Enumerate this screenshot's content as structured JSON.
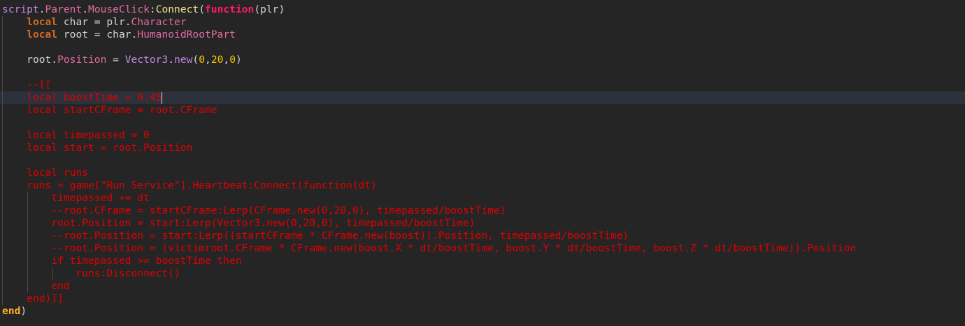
{
  "editor": {
    "cursor_line": 8,
    "lines": [
      {
        "indent": 0,
        "tokens": [
          [
            "script",
            "s"
          ],
          [
            ".",
            "t"
          ],
          [
            "Parent",
            "p"
          ],
          [
            ".",
            "t"
          ],
          [
            "MouseClick",
            "p"
          ],
          [
            ":",
            "t"
          ],
          [
            "Connect",
            "f"
          ],
          [
            "(",
            "t"
          ],
          [
            "function",
            "kw"
          ],
          [
            "(plr)",
            "t"
          ]
        ]
      },
      {
        "indent": 1,
        "tokens": [
          [
            "local",
            "loc"
          ],
          [
            " char = plr.",
            "t"
          ],
          [
            "Character",
            "p"
          ]
        ]
      },
      {
        "indent": 1,
        "tokens": [
          [
            "local",
            "loc"
          ],
          [
            " root = char.",
            "t"
          ],
          [
            "HumanoidRootPart",
            "p"
          ]
        ]
      },
      {
        "indent": 0,
        "tokens": []
      },
      {
        "indent": 1,
        "tokens": [
          [
            "root.",
            "t"
          ],
          [
            "Position",
            "p"
          ],
          [
            " = ",
            "t"
          ],
          [
            "Vector3",
            "v"
          ],
          [
            ".",
            "t"
          ],
          [
            "new",
            "v"
          ],
          [
            "(",
            "t"
          ],
          [
            "0",
            "n"
          ],
          [
            ",",
            "t"
          ],
          [
            "20",
            "n"
          ],
          [
            ",",
            "t"
          ],
          [
            "0",
            "n"
          ],
          [
            ")",
            "t"
          ]
        ]
      },
      {
        "indent": 0,
        "tokens": []
      },
      {
        "indent": 1,
        "tokens": [
          [
            "--[[",
            "c"
          ]
        ]
      },
      {
        "indent": 1,
        "tokens": [
          [
            "local boostTime = 0.45",
            "c"
          ]
        ]
      },
      {
        "indent": 1,
        "tokens": [
          [
            "local startCFrame = root.CFrame",
            "c"
          ]
        ]
      },
      {
        "indent": 0,
        "tokens": []
      },
      {
        "indent": 1,
        "tokens": [
          [
            "local timepassed = 0",
            "c"
          ]
        ]
      },
      {
        "indent": 1,
        "tokens": [
          [
            "local start = root.Position",
            "c"
          ]
        ]
      },
      {
        "indent": 0,
        "tokens": []
      },
      {
        "indent": 1,
        "tokens": [
          [
            "local runs",
            "c"
          ]
        ]
      },
      {
        "indent": 1,
        "tokens": [
          [
            "runs = game[\"Run Service\"].Heartbeat:Connect(function(dt)",
            "c"
          ]
        ]
      },
      {
        "indent": 2,
        "tokens": [
          [
            "timepassed += dt",
            "c"
          ]
        ]
      },
      {
        "indent": 2,
        "tokens": [
          [
            "--root.CFrame = startCFrame:Lerp(CFrame.new(0,20,0), timepassed/boostTime)",
            "c"
          ]
        ]
      },
      {
        "indent": 2,
        "tokens": [
          [
            "root.Position = start:Lerp(Vector3.new(0,20,0), timepassed/boostTime)",
            "c"
          ]
        ]
      },
      {
        "indent": 2,
        "tokens": [
          [
            "--root.Position = start:Lerp((startCFrame * CFrame.new(boost)).Position, timepassed/boostTime)",
            "c"
          ]
        ]
      },
      {
        "indent": 2,
        "tokens": [
          [
            "--root.Position = (victimroot.CFrame * CFrame.new(boost.X * dt/boostTime, boost.Y * dt/boostTime, boost.Z * dt/boostTime)).Position",
            "c"
          ]
        ]
      },
      {
        "indent": 2,
        "tokens": [
          [
            "if timepassed >= boostTime then",
            "c"
          ]
        ]
      },
      {
        "indent": 3,
        "tokens": [
          [
            "runs:Disconnect()",
            "c"
          ]
        ]
      },
      {
        "indent": 2,
        "tokens": [
          [
            "end",
            "c"
          ]
        ]
      },
      {
        "indent": 1,
        "tokens": [
          [
            "end)]]",
            "c"
          ]
        ]
      },
      {
        "indent": 0,
        "tokens": [
          [
            "end",
            "e"
          ],
          [
            ")",
            "t"
          ]
        ]
      }
    ]
  }
}
